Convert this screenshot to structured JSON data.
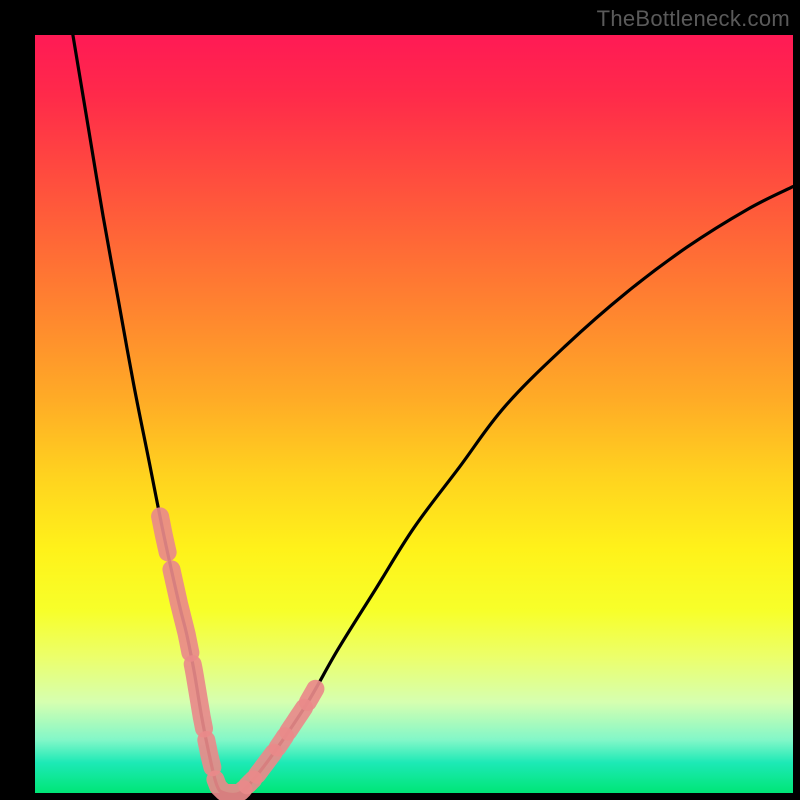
{
  "watermark": "TheBottleneck.com",
  "chart_data": {
    "type": "line",
    "title": "",
    "xlabel": "",
    "ylabel": "",
    "xlim": [
      0,
      100
    ],
    "ylim": [
      0,
      100
    ],
    "grid": false,
    "legend": false,
    "series": [
      {
        "name": "bottleneck-curve",
        "x": [
          5,
          7,
          9,
          11,
          13,
          15,
          17,
          19,
          20,
          21,
          22,
          23,
          24,
          25,
          27,
          29,
          32,
          36,
          40,
          45,
          50,
          56,
          62,
          70,
          78,
          86,
          94,
          100
        ],
        "values": [
          100,
          88,
          76,
          65,
          54,
          44,
          34,
          25,
          21,
          16,
          10,
          5,
          1,
          0,
          0,
          2,
          6,
          12,
          19,
          27,
          35,
          43,
          51,
          59,
          66,
          72,
          77,
          80
        ]
      }
    ],
    "markers": [
      {
        "series": "bottleneck-curve",
        "x_start": 16.5,
        "x_end": 17.5,
        "label": "left-marker-1"
      },
      {
        "series": "bottleneck-curve",
        "x_start": 18.0,
        "x_end": 20.5,
        "label": "left-marker-2"
      },
      {
        "series": "bottleneck-curve",
        "x_start": 20.8,
        "x_end": 22.3,
        "label": "left-marker-3"
      },
      {
        "series": "bottleneck-curve",
        "x_start": 22.6,
        "x_end": 23.4,
        "label": "left-marker-4"
      },
      {
        "series": "bottleneck-curve",
        "x_start": 23.8,
        "x_end": 27.5,
        "label": "bottom-marker"
      },
      {
        "series": "bottleneck-curve",
        "x_start": 28.0,
        "x_end": 28.8,
        "label": "right-marker-1"
      },
      {
        "series": "bottleneck-curve",
        "x_start": 29.3,
        "x_end": 31.5,
        "label": "right-marker-2"
      },
      {
        "series": "bottleneck-curve",
        "x_start": 32.0,
        "x_end": 33.0,
        "label": "right-marker-3"
      },
      {
        "series": "bottleneck-curve",
        "x_start": 33.4,
        "x_end": 35.5,
        "label": "right-marker-4"
      },
      {
        "series": "bottleneck-curve",
        "x_start": 36.0,
        "x_end": 37.0,
        "label": "right-marker-5"
      }
    ],
    "colors": {
      "curve": "#000000",
      "marker_fill": "#e98a8a",
      "marker_stroke": "#e98a8a",
      "background_top": "#ff1a55",
      "background_bottom": "#00e676"
    }
  }
}
